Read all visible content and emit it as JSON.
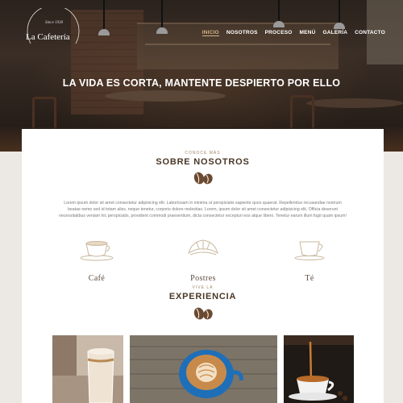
{
  "brand": {
    "since": "Since 1930",
    "name": "La Cafetería"
  },
  "nav": [
    {
      "label": "INICIO",
      "active": true
    },
    {
      "label": "NOSOTROS",
      "active": false
    },
    {
      "label": "PROCESO",
      "active": false
    },
    {
      "label": "MENÚ",
      "active": false
    },
    {
      "label": "GALERÍA",
      "active": false
    },
    {
      "label": "CONTACTO",
      "active": false
    }
  ],
  "hero": {
    "title": "LA VIDA ES CORTA, MANTENTE DESPIERTO POR ELLO"
  },
  "about": {
    "eyebrow": "CONOCE MÁS",
    "title": "SOBRE NOSOTROS",
    "text": "Lorem ipsum dolor sit amet consectetur adipisicing elit. Laboriosam in minima ut perspiciatis sapiente quos quaerat. Repellendus recusandae nostrum beatae nemo sed id totam aliss, neque tenetur, corporis dolore molestias. Lorem, ipsum dolor sit amet consectetur adipisicing elit. Officia deserunt necessitatibus veniam hic perspiciatis, provident commodi praesentium, dicta consectetur excepturi eos atque libero. Tenetur earum illum fugit quam ipsum!"
  },
  "features": [
    {
      "label": "Café",
      "icon": "coffee-cup-icon"
    },
    {
      "label": "Postres",
      "icon": "croissant-icon"
    },
    {
      "label": "Té",
      "icon": "tea-cup-icon"
    }
  ],
  "experience": {
    "eyebrow": "VIVE LA",
    "title": "EXPERIENCIA"
  },
  "gallery": [
    {
      "subject": "latte-glass"
    },
    {
      "subject": "latte-art-cup"
    },
    {
      "subject": "tea-pour"
    }
  ],
  "colors": {
    "accent": "#d4b48a",
    "heading": "#4a3727",
    "bean": "#6b4a30"
  }
}
